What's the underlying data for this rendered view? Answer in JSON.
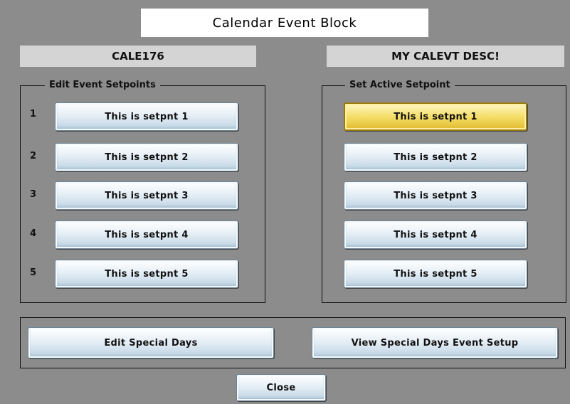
{
  "window": {
    "title": "Calendar Event Block"
  },
  "tags": {
    "name": "CALE176",
    "description": "MY CALEVT DESC!"
  },
  "edit_group": {
    "legend": "Edit Event Setpoints",
    "rows": [
      {
        "num": "1",
        "label": "This is setpnt 1"
      },
      {
        "num": "2",
        "label": "This is setpnt 2"
      },
      {
        "num": "3",
        "label": "This is setpnt 3"
      },
      {
        "num": "4",
        "label": "This is setpnt 4"
      },
      {
        "num": "5",
        "label": "This is setpnt 5"
      }
    ]
  },
  "active_group": {
    "legend": "Set Active Setpoint",
    "selected_index": 1,
    "items": [
      {
        "label": "This is setpnt 1"
      },
      {
        "label": "This is setpnt 2"
      },
      {
        "label": "This is setpnt 3"
      },
      {
        "label": "This is setpnt 4"
      },
      {
        "label": "This is setpnt 5"
      }
    ]
  },
  "special": {
    "edit_label": "Edit Special Days",
    "view_label": "View Special Days Event Setup"
  },
  "footer": {
    "close_label": "Close"
  },
  "colors": {
    "background": "#8c8c8c",
    "active_setpoint": "#f5de68",
    "button": "#dce8f1"
  }
}
